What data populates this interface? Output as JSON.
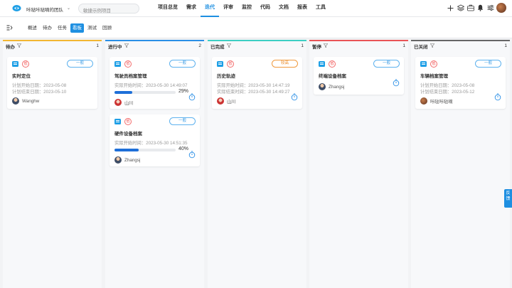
{
  "header": {
    "team": "咔哒咔哒嘀的团队",
    "project_placeholder": "敏捷示例项目",
    "nav": [
      {
        "label": "项目总览",
        "active": false
      },
      {
        "label": "需求",
        "active": false
      },
      {
        "label": "迭代",
        "active": true
      },
      {
        "label": "评审",
        "active": false
      },
      {
        "label": "监控",
        "active": false
      },
      {
        "label": "代码",
        "active": false
      },
      {
        "label": "文档",
        "active": false
      },
      {
        "label": "报表",
        "active": false
      },
      {
        "label": "工具",
        "active": false
      }
    ],
    "tool_icons": [
      "plus-icon",
      "layers-icon",
      "briefcase-icon",
      "bell-icon",
      "sliders-icon",
      "user-avatar"
    ]
  },
  "subnav": {
    "tabs": [
      {
        "label": "概述",
        "active": false
      },
      {
        "label": "待办",
        "active": false
      },
      {
        "label": "任务",
        "active": false
      },
      {
        "label": "看板",
        "active": true
      },
      {
        "label": "测试",
        "active": false
      },
      {
        "label": "回顾",
        "active": false
      }
    ]
  },
  "colors": {
    "accent": "#1e8fe1",
    "todo": "#f2b632",
    "in_progress": "#2a8fe6",
    "done": "#3ccfc4",
    "paused": "#e95457",
    "closed": "#666666"
  },
  "columns": [
    {
      "title": "待办",
      "count": "1",
      "color": "#f2b632",
      "cards": [
        {
          "title": "实时定位",
          "tag": "一般",
          "tag_style": "blue",
          "line1": "计划开始日期：2023-05-08",
          "line2": "计划结束日期：2023-05-10",
          "user": "Wanghw",
          "avatar": "man",
          "timer": false
        }
      ]
    },
    {
      "title": "进行中",
      "count": "2",
      "color": "#2a8fe6",
      "cards": [
        {
          "title": "驾驶员档案管理",
          "tag": "一般",
          "tag_style": "blue",
          "line1": "实际开始时间：2023-05-30 14:49:07",
          "progress": 29,
          "progress_label": "29%",
          "user": "山川",
          "avatar": "girl",
          "timer": true
        },
        {
          "title": "硬件设备档案",
          "tag": "一般",
          "tag_style": "blue",
          "line1": "实际开始时间：2023-05-30 14:51:35",
          "progress": 40,
          "progress_label": "40%",
          "user": "Zhangsj",
          "avatar": "man",
          "timer": true
        }
      ]
    },
    {
      "title": "已完成",
      "count": "1",
      "color": "#3ccfc4",
      "cards": [
        {
          "title": "历史轨迹",
          "tag": "较高",
          "tag_style": "orange",
          "line1": "实际开始时间：2023-05-30 14:47:19",
          "line2": "实际结束时间：2023-05-30 14:49:27",
          "user": "山川",
          "avatar": "girl",
          "timer": true
        }
      ]
    },
    {
      "title": "暂停",
      "count": "1",
      "color": "#e95457",
      "cards": [
        {
          "title": "终端设备档案",
          "tag": "一般",
          "tag_style": "blue",
          "user": "Zhangsj",
          "avatar": "man",
          "timer": true
        }
      ]
    },
    {
      "title": "已关闭",
      "count": "1",
      "color": "#666666",
      "cards": [
        {
          "title": "车辆档案管理",
          "tag": "一般",
          "tag_style": "blue",
          "line1": "计划开始日期：2023-05-08",
          "line2": "计划结束日期：2023-05-12",
          "user": "咔哒咔哒嘀",
          "avatar": "brown",
          "timer": true
        }
      ]
    }
  ],
  "priority_glyph": "低",
  "feedback": "反馈"
}
